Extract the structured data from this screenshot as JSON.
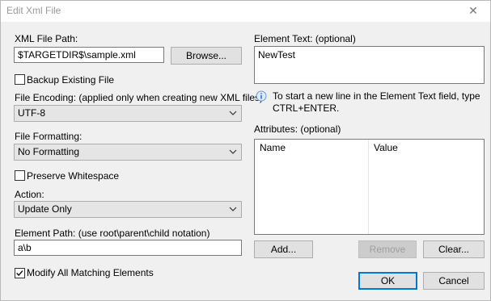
{
  "window": {
    "title": "Edit Xml File",
    "close_glyph": "✕"
  },
  "left": {
    "xml_path_label": "XML File Path:",
    "xml_path_value": "$TARGETDIR$\\sample.xml",
    "browse_label": "Browse...",
    "backup_label": "Backup Existing File",
    "backup_checked": false,
    "encoding_label": "File Encoding: (applied only when creating new XML files)",
    "encoding_value": "UTF-8",
    "formatting_label": "File Formatting:",
    "formatting_value": "No Formatting",
    "preserve_label": "Preserve Whitespace",
    "preserve_checked": false,
    "action_label": "Action:",
    "action_value": "Update Only",
    "element_path_label": "Element Path: (use root\\parent\\child notation)",
    "element_path_value": "a\\b",
    "modify_all_label": "Modify All Matching Elements",
    "modify_all_checked": true
  },
  "right": {
    "element_text_label": "Element Text: (optional)",
    "element_text_value": "NewTest",
    "hint_text": "To start a new line in the Element Text field, type CTRL+ENTER.",
    "attributes_label": "Attributes: (optional)",
    "attributes_columns": [
      "Name",
      "Value"
    ],
    "add_label": "Add...",
    "remove_label": "Remove",
    "clear_label": "Clear...",
    "ok_label": "OK",
    "cancel_label": "Cancel"
  },
  "icons": {
    "chevron": "chevron-down-icon",
    "info": "info-icon",
    "check": "checkmark-icon"
  }
}
